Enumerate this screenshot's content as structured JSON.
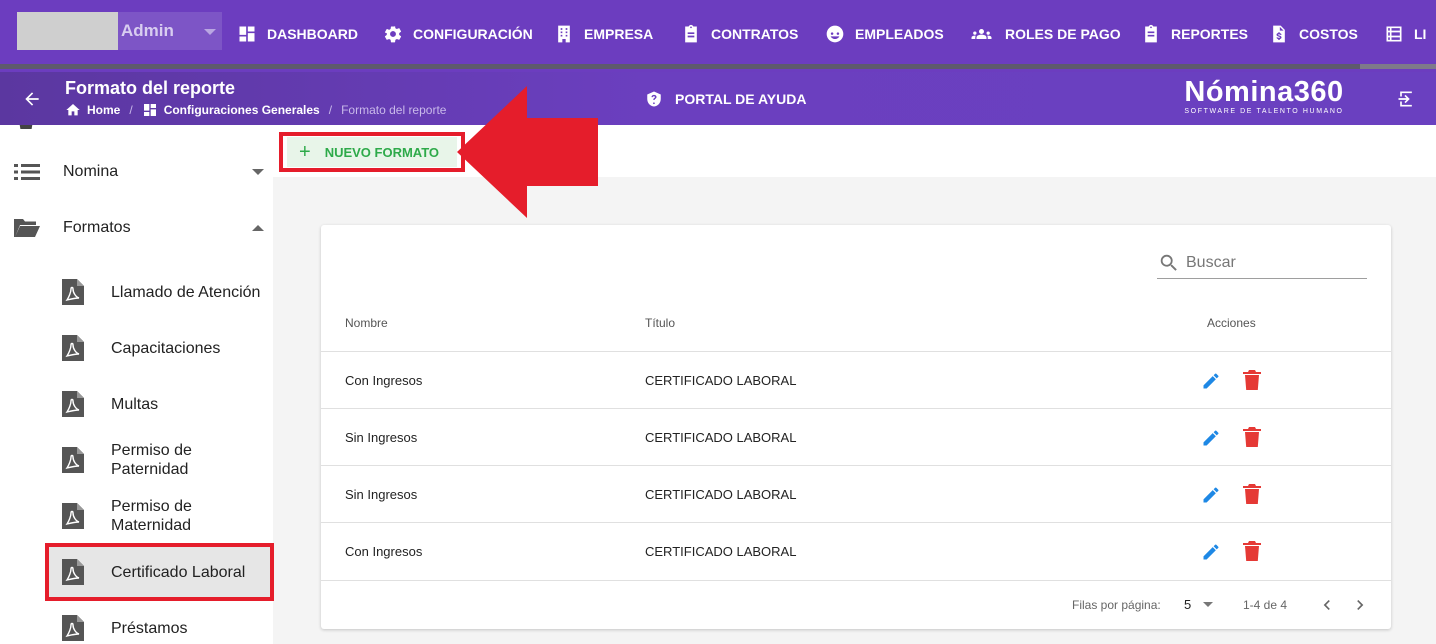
{
  "header": {
    "user": {
      "name": "Admin"
    },
    "nav": [
      {
        "label": "DASHBOARD",
        "icon": "dashboard-icon"
      },
      {
        "label": "CONFIGURACIÓN",
        "icon": "gear-icon"
      },
      {
        "label": "EMPRESA",
        "icon": "building-icon"
      },
      {
        "label": "CONTRATOS",
        "icon": "clipboard-icon"
      },
      {
        "label": "EMPLEADOS",
        "icon": "face-icon"
      },
      {
        "label": "ROLES DE PAGO",
        "icon": "group-icon"
      },
      {
        "label": "REPORTES",
        "icon": "clipboard-list-icon"
      },
      {
        "label": "COSTOS",
        "icon": "invoice-dollar-icon"
      },
      {
        "label": "LI",
        "icon": "list-icon"
      }
    ]
  },
  "subheader": {
    "title": "Formato del reporte",
    "breadcrumb": {
      "home": "Home",
      "section": "Configuraciones Generales",
      "current": "Formato del reporte",
      "separator": "/"
    },
    "help_label": "PORTAL DE AYUDA",
    "logo": {
      "main": "Nómina360",
      "tagline": "SOFTWARE DE TALENTO HUMANO"
    }
  },
  "sidebar": {
    "groups": [
      {
        "label": "Nomina",
        "icon": "list-icon",
        "expanded": false
      },
      {
        "label": "Formatos",
        "icon": "folder-open-icon",
        "expanded": true
      }
    ],
    "items": [
      {
        "label": "Llamado de Atención"
      },
      {
        "label": "Capacitaciones"
      },
      {
        "label": "Multas"
      },
      {
        "label": "Permiso de Paternidad"
      },
      {
        "label": "Permiso de Maternidad"
      },
      {
        "label": "Certificado Laboral",
        "active": true
      },
      {
        "label": "Préstamos"
      }
    ]
  },
  "toolbar": {
    "new_button": "NUEVO FORMATO",
    "new_icon": "plus-icon"
  },
  "table": {
    "search_placeholder": "Buscar",
    "columns": {
      "nombre": "Nombre",
      "titulo": "Título",
      "acciones": "Acciones"
    },
    "rows": [
      {
        "nombre": "Con Ingresos",
        "titulo": "CERTIFICADO LABORAL"
      },
      {
        "nombre": "Sin Ingresos",
        "titulo": "CERTIFICADO LABORAL"
      },
      {
        "nombre": "Sin Ingresos",
        "titulo": "CERTIFICADO LABORAL"
      },
      {
        "nombre": "Con Ingresos",
        "titulo": "CERTIFICADO LABORAL"
      }
    ],
    "pagination": {
      "rows_per_page_label": "Filas por página:",
      "rows_per_page": "5",
      "range": "1-4 de 4"
    }
  },
  "colors": {
    "nav_bg": "#6c3dbf",
    "accent_green": "#2eaa4a",
    "highlight_red": "#e51d2b",
    "edit_blue": "#1e88e5",
    "delete_red": "#e53935"
  }
}
